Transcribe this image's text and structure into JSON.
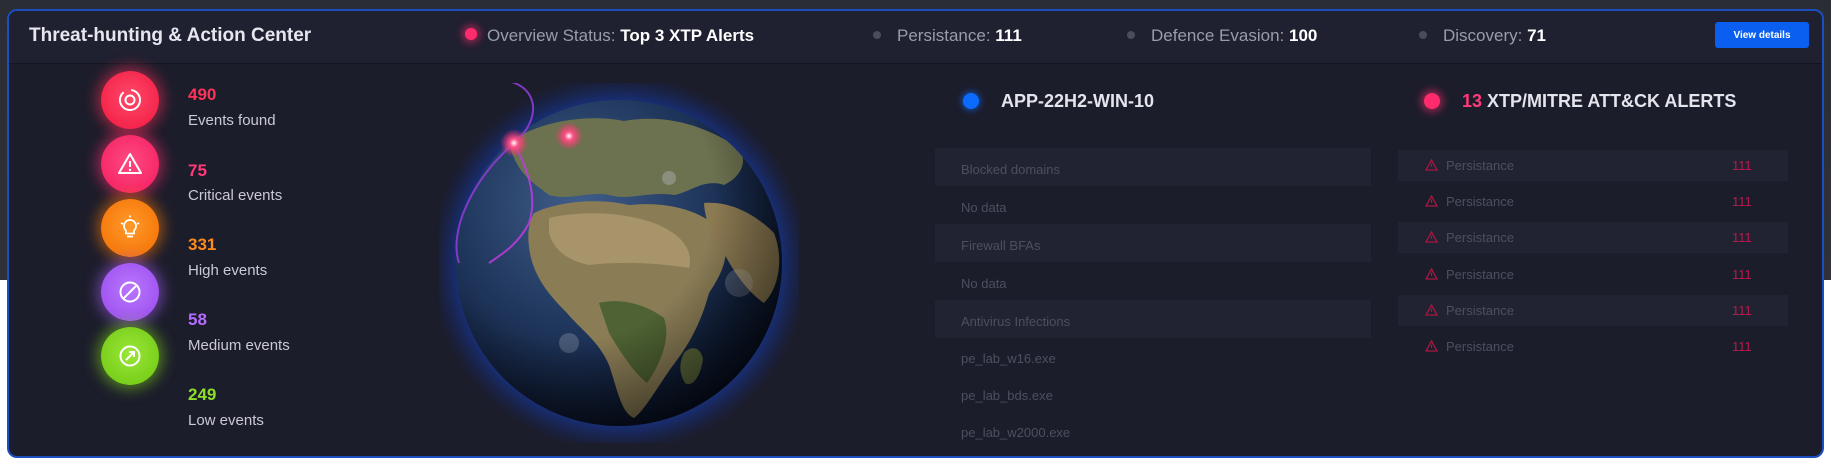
{
  "header": {
    "title": "Threat-hunting & Action Center",
    "overview_label": "Overview Status:",
    "overview_value": "Top 3 XTP Alerts",
    "stats": [
      {
        "label": "Persistance:",
        "value": "111"
      },
      {
        "label": "Defence Evasion:",
        "value": "100"
      },
      {
        "label": "Discovery:",
        "value": "71"
      }
    ],
    "view_button": "View details"
  },
  "events": [
    {
      "count": "490",
      "label": "Events found",
      "icon": "target-icon",
      "color": "#ff2d55"
    },
    {
      "count": "75",
      "label": "Critical events",
      "icon": "warning-icon",
      "color": "#ff2d6e"
    },
    {
      "count": "331",
      "label": "High events",
      "icon": "lightbulb-icon",
      "color": "#ff7a00"
    },
    {
      "count": "58",
      "label": "Medium events",
      "icon": "blocked-icon",
      "color": "#a35cf0"
    },
    {
      "count": "249",
      "label": "Low events",
      "icon": "arrow-up-right-icon",
      "color": "#7fd319"
    }
  ],
  "host": {
    "name": "APP-22H2-WIN-10",
    "rows": [
      {
        "text": "Blocked domains",
        "kind": "header"
      },
      {
        "text": "No data",
        "kind": "value"
      },
      {
        "text": "Firewall BFAs",
        "kind": "header"
      },
      {
        "text": "No data",
        "kind": "value"
      },
      {
        "text": "Antivirus Infections",
        "kind": "header"
      },
      {
        "text": "pe_lab_w16.exe",
        "kind": "value"
      },
      {
        "text": "pe_lab_bds.exe",
        "kind": "value"
      },
      {
        "text": "pe_lab_w2000.exe",
        "kind": "value"
      }
    ]
  },
  "alerts": {
    "count": "13",
    "title": "XTP/MITRE ATT&CK ALERTS",
    "rows": [
      {
        "label": "Persistance",
        "value": "111"
      },
      {
        "label": "Persistance",
        "value": "111"
      },
      {
        "label": "Persistance",
        "value": "111"
      },
      {
        "label": "Persistance",
        "value": "111"
      },
      {
        "label": "Persistance",
        "value": "111"
      },
      {
        "label": "Persistance",
        "value": "111"
      }
    ]
  }
}
